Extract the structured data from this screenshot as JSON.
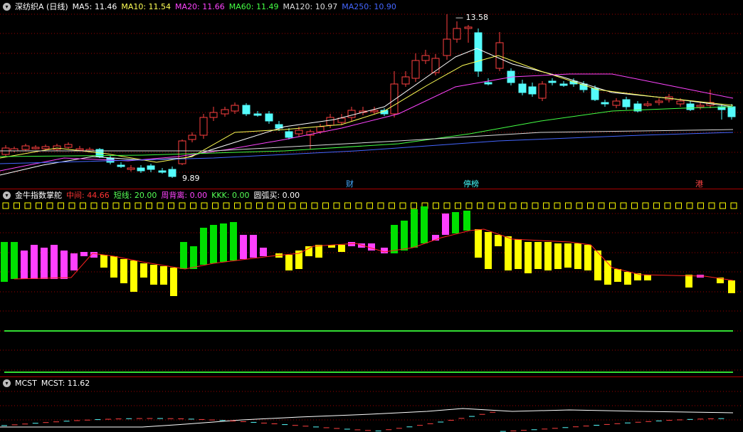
{
  "main_panel": {
    "stock_title": "深纺织A (日线)",
    "ma_labels": [
      {
        "text": "MA5: 11.46",
        "color": "#ffffff"
      },
      {
        "text": "MA10: 11.54",
        "color": "#ffff55"
      },
      {
        "text": "MA20: 11.66",
        "color": "#ff44ff"
      },
      {
        "text": "MA60: 11.49",
        "color": "#44ff44"
      },
      {
        "text": "MA120: 10.97",
        "color": "#dddddd"
      },
      {
        "text": "MA250: 10.90",
        "color": "#4466ff"
      }
    ],
    "high_label": "13.58",
    "low_label": "9.89",
    "tags": [
      "财",
      "停榜",
      "港"
    ]
  },
  "indicator_panel": {
    "name": "金牛指数掌舵",
    "values": [
      {
        "text": "中间: 44.66",
        "color": "#ff3333"
      },
      {
        "text": "短线: 20.00",
        "color": "#55ff55"
      },
      {
        "text": "周背离: 0.00",
        "color": "#ff44ff"
      },
      {
        "text": "KKK: 0.00",
        "color": "#55ff55"
      },
      {
        "text": "圆弧买: 0.00",
        "color": "#ffffff"
      }
    ]
  },
  "mcst_panel": {
    "name": "MCST",
    "value_text": "MCST: 11.62"
  },
  "colors": {
    "up": "#ff4040",
    "down": "#54fcfc",
    "grid_red": "#a00000",
    "bar_green": "#00e000",
    "bar_magenta": "#ff40ff",
    "bar_yellow": "#ffff00"
  }
}
